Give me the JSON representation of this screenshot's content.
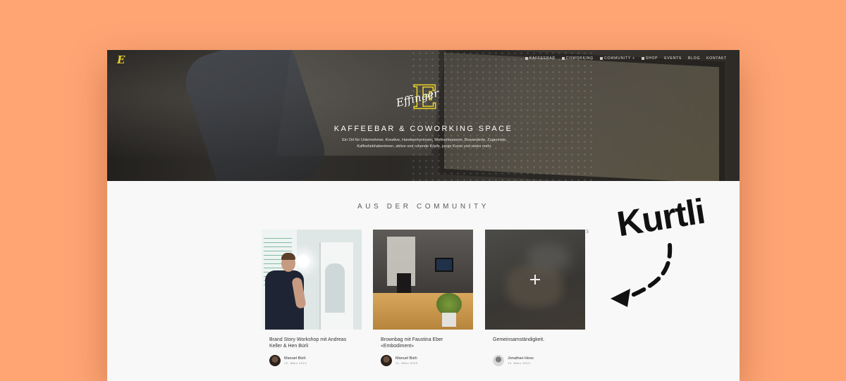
{
  "nav": {
    "items": [
      {
        "label": "Kaffeebar",
        "icon": "square-icon"
      },
      {
        "label": "Coworking",
        "icon": "square-icon"
      },
      {
        "label": "Community +",
        "icon": "square-icon"
      },
      {
        "label": "Shop",
        "icon": "square-icon"
      },
      {
        "label": "Events"
      },
      {
        "label": "Blog"
      },
      {
        "label": "Kontakt"
      }
    ]
  },
  "hero": {
    "brand": "Effinger",
    "brand_letter": "E",
    "title": "KAFFEEBAR & COWORKING SPACE",
    "description": "Ein Ort für Unternehmer, Kreative, Handwerkerinnen, Weltverbesserer, Bewanderte, Zugereiste, Kaffeeliebhaberinnen, aktive und ruhende Köpfe, junge Kunst und vieles mehr."
  },
  "community": {
    "title": "AUS DER COMMUNITY",
    "cards": [
      {
        "title": "Brand Story Workshop mit Andreas Keller & Hen Bürli",
        "author": "Manuel Bürli",
        "date": "12. März 2019"
      },
      {
        "title": "Brownbag mit Faustina Eber «Embodiment»",
        "author": "Manuel Bürli",
        "date": "11. März 2019"
      },
      {
        "title": "Gemeinsamständigkeit.",
        "author": "Jonathan Hess",
        "date": "10. März 2019"
      }
    ],
    "edge_number": "3"
  },
  "annotation": {
    "text": "Kurtli"
  },
  "colors": {
    "background": "#ffa574",
    "accent": "#e9d12b",
    "page": "#f8f8f8"
  }
}
